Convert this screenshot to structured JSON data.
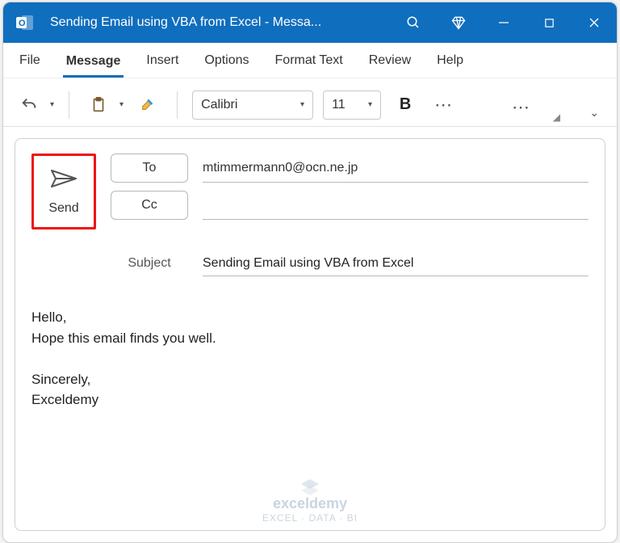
{
  "window": {
    "title": "Sending Email using VBA from Excel  -  Messa..."
  },
  "menu": {
    "file": "File",
    "message": "Message",
    "insert": "Insert",
    "options": "Options",
    "formattext": "Format Text",
    "review": "Review",
    "help": "Help"
  },
  "ribbon": {
    "font": "Calibri",
    "size": "11",
    "bold": "B"
  },
  "compose": {
    "send": "Send",
    "to_label": "To",
    "cc_label": "Cc",
    "to_value": "mtimmermann0@ocn.ne.jp",
    "cc_value": "",
    "subject_label": "Subject",
    "subject_value": "Sending Email using VBA from Excel",
    "body": "Hello,\nHope this email finds you well.\n\nSincerely,\nExceldemy"
  },
  "watermark": {
    "brand": "exceldemy",
    "tag": "EXCEL · DATA · BI"
  }
}
